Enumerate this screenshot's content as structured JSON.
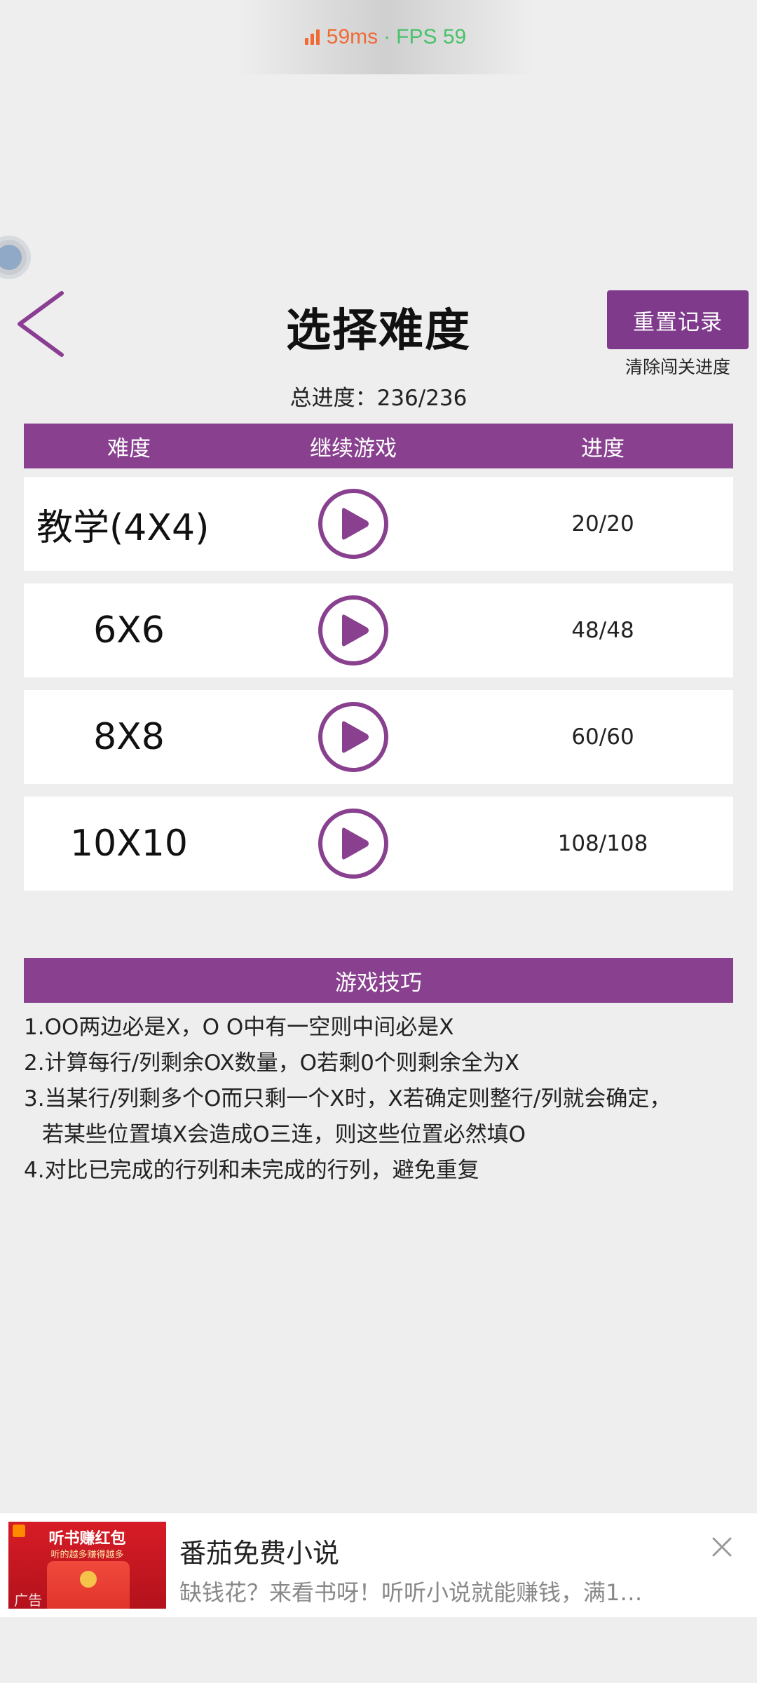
{
  "perf": {
    "latency": "59ms",
    "separator": "·",
    "fps": "FPS 59"
  },
  "header": {
    "title": "选择难度",
    "reset_button": "重置记录",
    "reset_hint": "清除闯关进度",
    "total_progress": "总进度：236/236"
  },
  "table": {
    "headers": [
      "难度",
      "继续游戏",
      "进度"
    ],
    "rows": [
      {
        "level": "教学(4X4)",
        "progress": "20/20"
      },
      {
        "level": "6X6",
        "progress": "48/48"
      },
      {
        "level": "8X8",
        "progress": "60/60"
      },
      {
        "level": "10X10",
        "progress": "108/108"
      }
    ]
  },
  "tips": {
    "title": "游戏技巧",
    "lines": [
      "1.OO两边必是X，O O中有一空则中间必是X",
      "2.计算每行/列剩余OX数量，O若剩0个则剩余全为X",
      "3.当某行/列剩多个O而只剩一个X时，X若确定则整行/列就会确定，",
      "若某些位置填X会造成O三连，则这些位置必然填O",
      "4.对比已完成的行列和未完成的行列，避免重复"
    ]
  },
  "ad": {
    "image_title": "听书赚红包",
    "image_subtitle": "听的越多赚得越多",
    "image_tag": "广告",
    "title": "番茄免费小说",
    "description": "缺钱花？来看书呀！听听小说就能赚钱，满1…"
  },
  "colors": {
    "accent": "#88408f",
    "button": "#7f3a8c",
    "background": "#eeeeee",
    "perf_latency": "#f06a35",
    "perf_fps": "#49c26b"
  },
  "icons": {
    "back": "chevron-left-icon",
    "play": "play-circle-icon",
    "close": "close-icon"
  }
}
